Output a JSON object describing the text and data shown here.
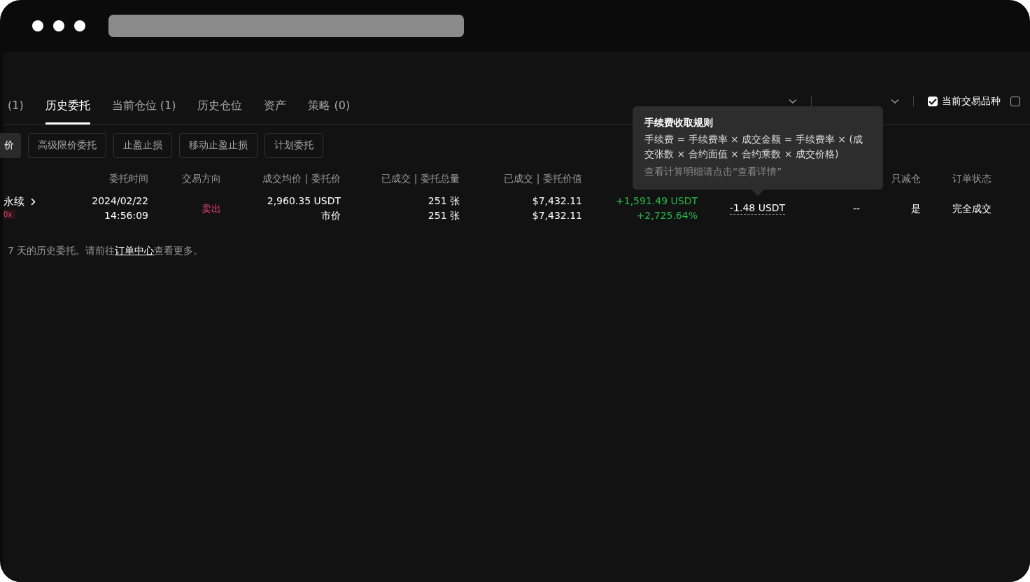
{
  "tabs": [
    {
      "label": "(1)",
      "selected": false
    },
    {
      "label": "历史委托",
      "selected": true
    },
    {
      "label": "当前仓位 (1)",
      "selected": false
    },
    {
      "label": "历史仓位",
      "selected": false
    },
    {
      "label": "资产",
      "selected": false
    },
    {
      "label": "策略 (0)",
      "selected": false
    }
  ],
  "filters": [
    {
      "kind": "dropdown"
    },
    {
      "kind": "dropdown"
    },
    {
      "kind": "checkbox",
      "label": "当前交易品种",
      "checked": true
    },
    {
      "kind": "checkbox",
      "checked": false
    }
  ],
  "order_types": [
    {
      "label": "价",
      "selected": true
    },
    {
      "label": "高级限价委托",
      "selected": false
    },
    {
      "label": "止盈止损",
      "selected": false
    },
    {
      "label": "移动止盈止损",
      "selected": false
    },
    {
      "label": "计划委托",
      "selected": false
    }
  ],
  "table": {
    "columns": [
      {},
      {
        "header": "委托时间"
      },
      {
        "header": "交易方向"
      },
      {
        "header": "成交均价 | 委托价"
      },
      {
        "header": "已成交 | 委托总量"
      },
      {
        "header": "已成交 | 委托价值"
      },
      {},
      {},
      {},
      {
        "header": "只减仓"
      },
      {
        "header": "订单状态"
      }
    ],
    "rows": [
      {
        "cells": [
          {
            "kind": "product",
            "lines": [
              "永续"
            ],
            "badge": "0x"
          },
          {
            "kind": "text",
            "lines": [
              "2024/02/22",
              "14:56:09"
            ]
          },
          {
            "kind": "text",
            "color": "#e0407a",
            "lines": [
              "卖出"
            ]
          },
          {
            "kind": "text",
            "lines": [
              "2,960.35 USDT",
              "市价"
            ]
          },
          {
            "kind": "text",
            "lines": [
              "251 张",
              "251 张"
            ]
          },
          {
            "kind": "text",
            "lines": [
              "$7,432.11",
              "$7,432.11"
            ]
          },
          {
            "kind": "text",
            "color": "#25b84a",
            "lines": [
              "+1,591.49 USDT",
              "+2,725.64%"
            ]
          },
          {
            "kind": "fee",
            "lines": [
              "-1.48 USDT"
            ]
          },
          {
            "kind": "text",
            "lines": [
              "--"
            ]
          },
          {
            "kind": "text",
            "lines": [
              "是"
            ]
          },
          {
            "kind": "text",
            "lines": [
              "完全成交"
            ]
          }
        ]
      }
    ]
  },
  "tooltip": {
    "title": "手续费收取规则",
    "body": "手续费 = 手续费率 × 成交金额 = 手续费率 × (成交张数 × 合约面值 × 合约乘数 × 成交价格)",
    "hint": "查看计算明细请点击“查看详情”"
  },
  "footer": {
    "before": "7 天的历史委托。请前往",
    "link": "订单中心",
    "after": "查看更多。"
  }
}
